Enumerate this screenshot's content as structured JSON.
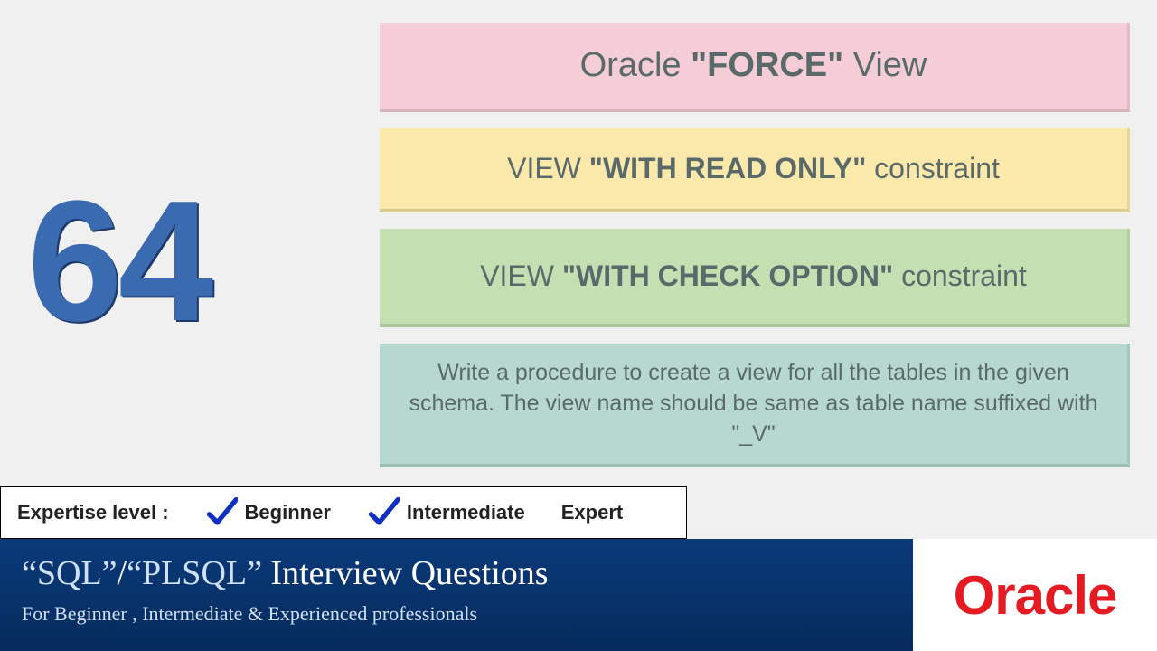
{
  "slide_number": "64",
  "cards": {
    "pink_pre": "Oracle ",
    "pink_b": "\"FORCE\"",
    "pink_post": " View",
    "yellow_pre": "VIEW ",
    "yellow_b": "\"WITH READ ONLY\"",
    "yellow_post": " constraint",
    "green_pre": "VIEW ",
    "green_b": "\"WITH CHECK OPTION\"",
    "green_post": " constraint",
    "teal": "Write a procedure to create a view for all the tables in the given schema. The view name should be same as table name suffixed with \"_V\""
  },
  "expertise": {
    "label": "Expertise level :",
    "levels": {
      "beginner": "Beginner",
      "intermediate": "Intermediate",
      "expert": "Expert"
    }
  },
  "footer": {
    "title_q1": "“SQL”",
    "title_sep": "/",
    "title_q2": "“PLSQL”",
    "title_rest": "  Interview Questions",
    "sub": "For Beginner , Intermediate & Experienced professionals"
  },
  "brand": "Oracle"
}
